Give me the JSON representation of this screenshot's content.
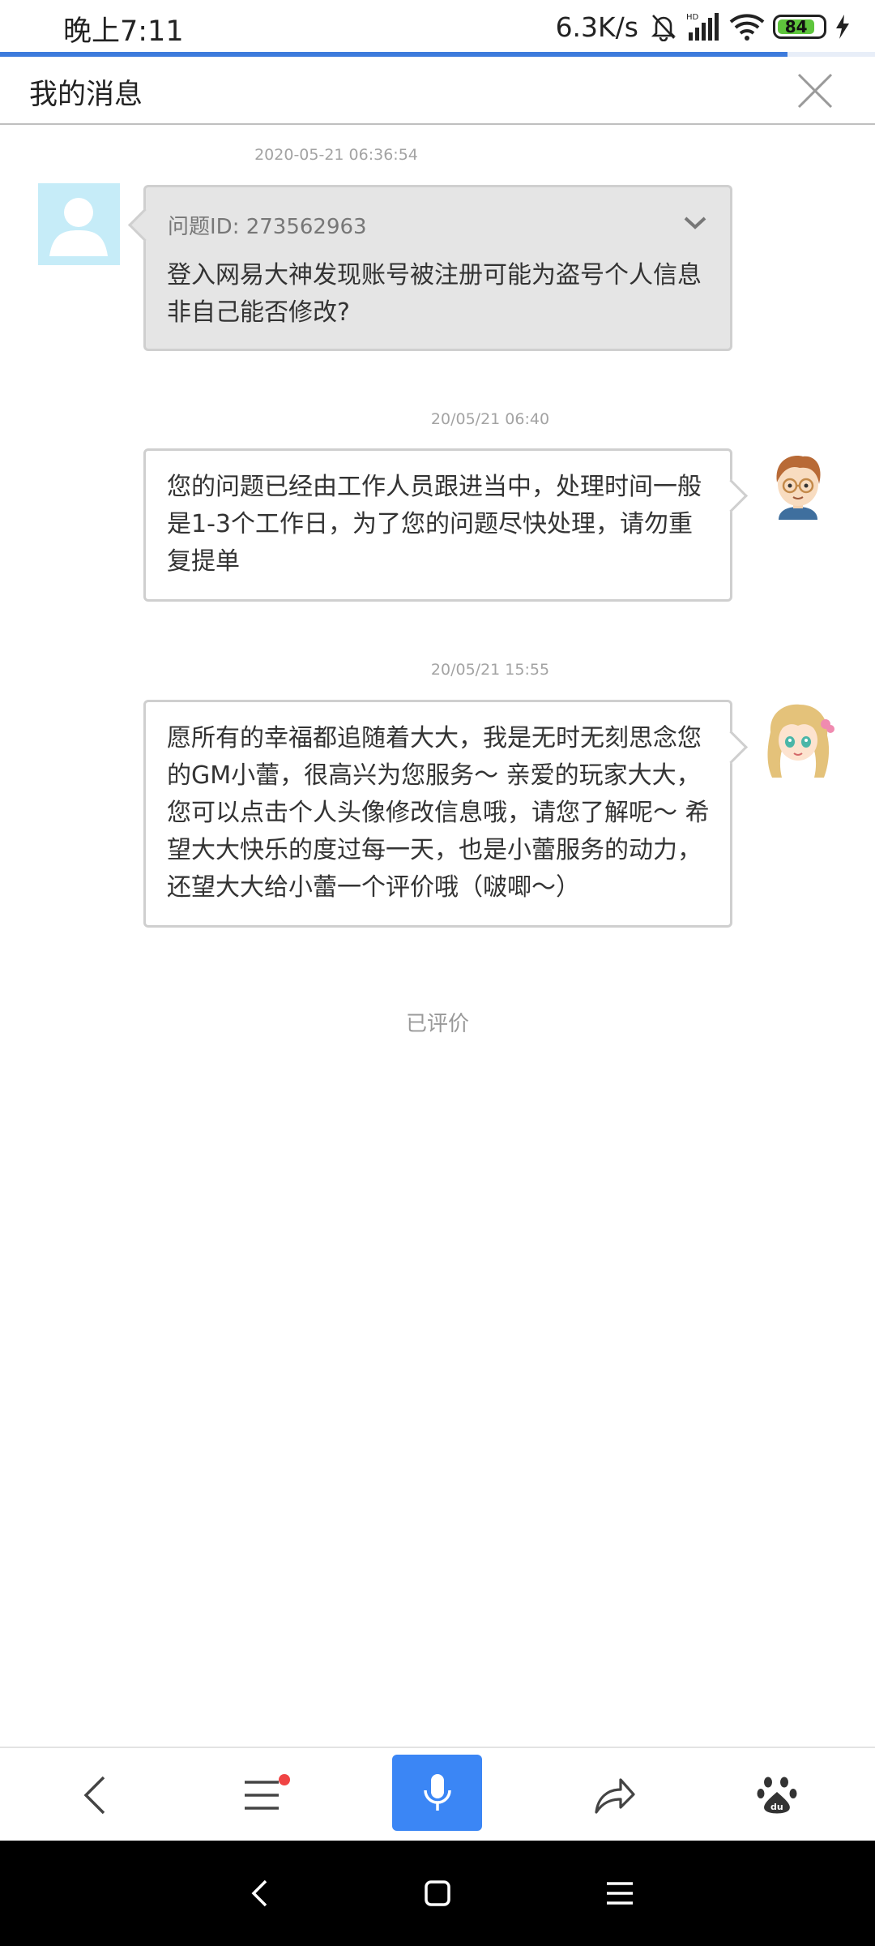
{
  "status_bar": {
    "time": "晚上7:11",
    "net_speed": "6.3K/s",
    "battery": "84",
    "icons": [
      "bell-off-icon",
      "hd-signal-icon",
      "wifi-icon",
      "battery-icon",
      "charging-icon"
    ]
  },
  "page_load_progress": 0.9,
  "header": {
    "title": "我的消息",
    "close_icon": "close-icon"
  },
  "messages": [
    {
      "timestamp": "2020-05-21 06:36:54",
      "question_id": "问题ID: 273562963",
      "text": "登入网易大神发现账号被注册可能为盗号个人信息非自己能否修改?"
    },
    {
      "timestamp": "20/05/21 06:40",
      "text": "您的问题已经由工作人员跟进当中，处理时间一般是1-3个工作日，为了您的问题尽快处理，请勿重复提单"
    },
    {
      "timestamp": "20/05/21 15:55",
      "text": "愿所有的幸福都追随着大大，我是无时无刻思念您的GM小蕾，很高兴为您服务～ 亲爱的玩家大大，您可以点击个人头像修改信息哦，请您了解呢～ 希望大大快乐的度过每一天，也是小蕾服务的动力，还望大大给小蕾一个评价哦（啵唧～）"
    }
  ],
  "rated_label": "已评价",
  "toolbar": {
    "icons": [
      "back-icon",
      "menu-icon",
      "microphone-icon",
      "share-icon",
      "baidu-paw-icon"
    ],
    "accent": "#3b86f5",
    "badge_color": "#f04444"
  },
  "nav_bar": {
    "icons": [
      "nav-back-icon",
      "nav-home-icon",
      "nav-recents-icon"
    ]
  }
}
